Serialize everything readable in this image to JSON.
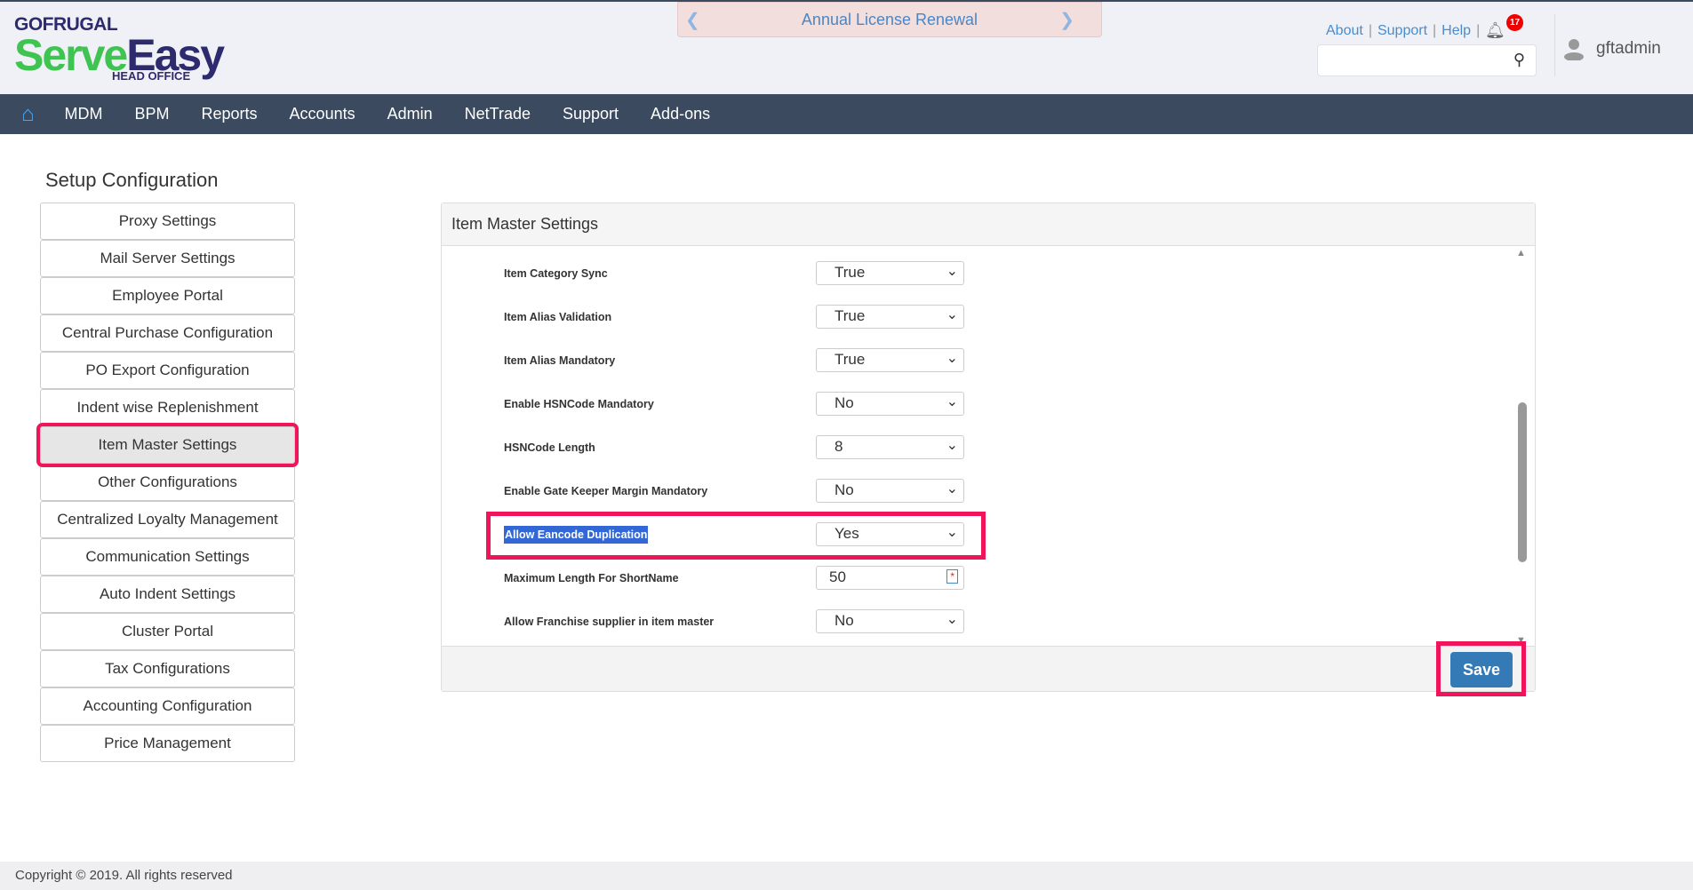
{
  "logo": {
    "brand": "GOFRUGAL",
    "product_a": "Serve",
    "product_b": "Easy",
    "subtitle": "HEAD OFFICE"
  },
  "banner": {
    "text": "Annual License Renewal"
  },
  "header_links": [
    "About",
    "Support",
    "Help"
  ],
  "notifications": {
    "count": "17"
  },
  "search": {
    "placeholder": ""
  },
  "user": {
    "name": "gftadmin"
  },
  "nav": [
    "MDM",
    "BPM",
    "Reports",
    "Accounts",
    "Admin",
    "NetTrade",
    "Support",
    "Add-ons"
  ],
  "sidebar": {
    "title": "Setup Configuration",
    "items": [
      "Proxy Settings",
      "Mail Server Settings",
      "Employee Portal",
      "Central Purchase Configuration",
      "PO Export Configuration",
      "Indent wise Replenishment",
      "Item Master Settings",
      "Other Configurations",
      "Centralized Loyalty Management",
      "Communication Settings",
      "Auto Indent Settings",
      "Cluster Portal",
      "Tax Configurations",
      "Accounting Configuration",
      "Price Management"
    ],
    "active": "Item Master Settings"
  },
  "panel": {
    "title": "Item Master Settings",
    "rows": [
      {
        "label": "Item Category Sync",
        "value": "True",
        "type": "select"
      },
      {
        "label": "Item Alias Validation",
        "value": "True",
        "type": "select"
      },
      {
        "label": "Item Alias Mandatory",
        "value": "True",
        "type": "select"
      },
      {
        "label": "Enable HSNCode Mandatory",
        "value": "No",
        "type": "select"
      },
      {
        "label": "HSNCode Length",
        "value": "8",
        "type": "select"
      },
      {
        "label": "Enable Gate Keeper Margin Mandatory",
        "value": "No",
        "type": "select"
      },
      {
        "label": "Allow Eancode Duplication",
        "value": "Yes",
        "type": "select"
      },
      {
        "label": "Maximum Length For ShortName",
        "value": "50",
        "type": "input"
      },
      {
        "label": "Allow Franchise supplier in item master",
        "value": "No",
        "type": "select"
      }
    ],
    "save_label": "Save"
  },
  "footer": {
    "copyright": "Copyright © 2019. All rights reserved"
  },
  "colors": {
    "highlight": "#f0145a",
    "nav": "#3b4a5f",
    "primary": "#337ab7"
  }
}
